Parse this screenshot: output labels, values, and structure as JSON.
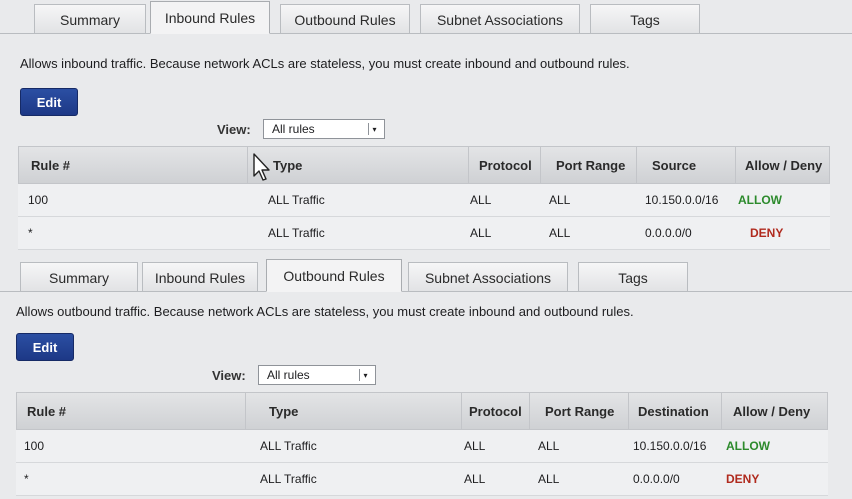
{
  "panels": [
    {
      "tabs": [
        {
          "label": "Summary"
        },
        {
          "label": "Inbound Rules",
          "active": true
        },
        {
          "label": "Outbound Rules"
        },
        {
          "label": "Subnet Associations"
        },
        {
          "label": "Tags"
        }
      ],
      "description": "Allows inbound traffic. Because network ACLs are stateless, you must create inbound and outbound rules.",
      "edit_label": "Edit",
      "view_label": "View:",
      "view_value": "All rules",
      "columns": [
        "Rule #",
        "Type",
        "Protocol",
        "Port Range",
        "Source",
        "Allow / Deny"
      ],
      "rows": [
        {
          "rule": "100",
          "type": "ALL Traffic",
          "protocol": "ALL",
          "port_range": "ALL",
          "address": "10.150.0.0/16",
          "action": "ALLOW"
        },
        {
          "rule": "*",
          "type": "ALL Traffic",
          "protocol": "ALL",
          "port_range": "ALL",
          "address": "0.0.0.0/0",
          "action": "DENY"
        }
      ]
    },
    {
      "tabs": [
        {
          "label": "Summary"
        },
        {
          "label": "Inbound Rules"
        },
        {
          "label": "Outbound Rules",
          "active": true
        },
        {
          "label": "Subnet Associations"
        },
        {
          "label": "Tags"
        }
      ],
      "description": "Allows outbound traffic. Because network ACLs are stateless, you must create inbound and outbound rules.",
      "edit_label": "Edit",
      "view_label": "View:",
      "view_value": "All rules",
      "columns": [
        "Rule #",
        "Type",
        "Protocol",
        "Port Range",
        "Destination",
        "Allow / Deny"
      ],
      "rows": [
        {
          "rule": "100",
          "type": "ALL Traffic",
          "protocol": "ALL",
          "port_range": "ALL",
          "address": "10.150.0.0/16",
          "action": "ALLOW"
        },
        {
          "rule": "*",
          "type": "ALL Traffic",
          "protocol": "ALL",
          "port_range": "ALL",
          "address": "0.0.0.0/0",
          "action": "DENY"
        }
      ]
    }
  ],
  "colors": {
    "allow": "#2c8a2c",
    "deny": "#b02a1e",
    "button": "#1d3886"
  }
}
